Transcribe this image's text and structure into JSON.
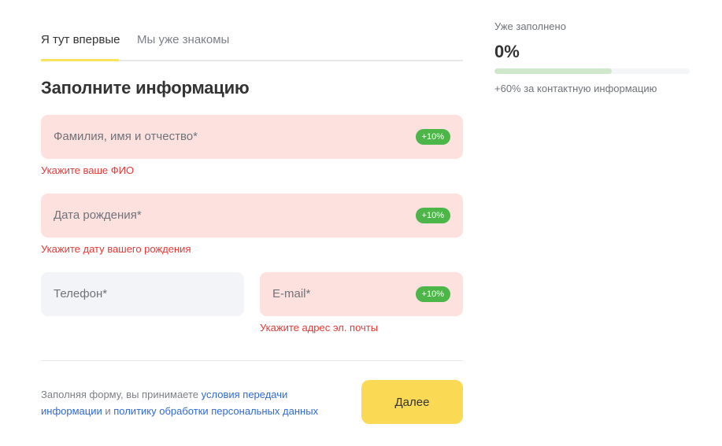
{
  "tabs": [
    {
      "label": "Я тут впервые",
      "active": true
    },
    {
      "label": "Мы уже знакомы",
      "active": false
    }
  ],
  "form": {
    "title": "Заполните информацию",
    "fields": {
      "full_name": {
        "label": "Фамилия, имя и отчество*",
        "bonus": "+10%",
        "error": "Укажите ваше ФИО",
        "state": "error"
      },
      "birth_date": {
        "label": "Дата рождения*",
        "bonus": "+10%",
        "error": "Укажите дату вашего рождения",
        "state": "error"
      },
      "phone": {
        "label": "Телефон*",
        "state": "default"
      },
      "email": {
        "label": "E-mail*",
        "bonus": "+10%",
        "error": "Укажите адрес эл. почты",
        "state": "error"
      }
    },
    "consent": {
      "prefix": "Заполняя форму, вы принимаете ",
      "link1": "условия передачи информации",
      "middle": " и ",
      "link2": "политику обработки персональных данных"
    },
    "next_button": "Далее"
  },
  "progress": {
    "caption": "Уже заполнено",
    "value_text": "0%",
    "preview_fraction": 0.6,
    "hint": "+60% за контактную информацию"
  },
  "colors": {
    "accent_yellow": "#fad955",
    "error_red": "#e53935",
    "error_field_bg": "#fde1df",
    "bonus_green": "#4cb748",
    "progress_preview": "#cfe8cc",
    "link_blue": "#2f6bd6"
  }
}
